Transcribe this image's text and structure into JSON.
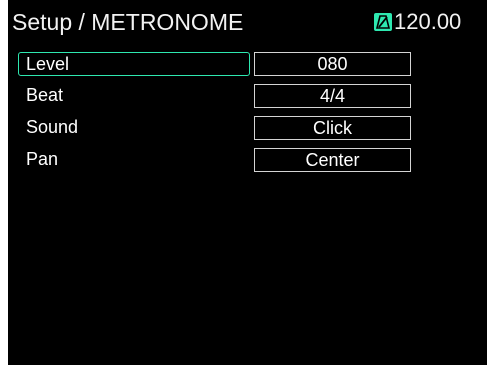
{
  "header": {
    "title": "Setup / METRONOME",
    "tempo": "120.00",
    "tempo_icon": "metronome-icon"
  },
  "parameters": [
    {
      "label": "Level",
      "value": "080",
      "selected": true
    },
    {
      "label": "Beat",
      "value": "4/4",
      "selected": false
    },
    {
      "label": "Sound",
      "value": "Click",
      "selected": false
    },
    {
      "label": "Pan",
      "value": "Center",
      "selected": false
    }
  ],
  "colors": {
    "background": "#000000",
    "text": "#ffffff",
    "accent": "#2ee8b0",
    "value_border": "#d4d4d4"
  }
}
